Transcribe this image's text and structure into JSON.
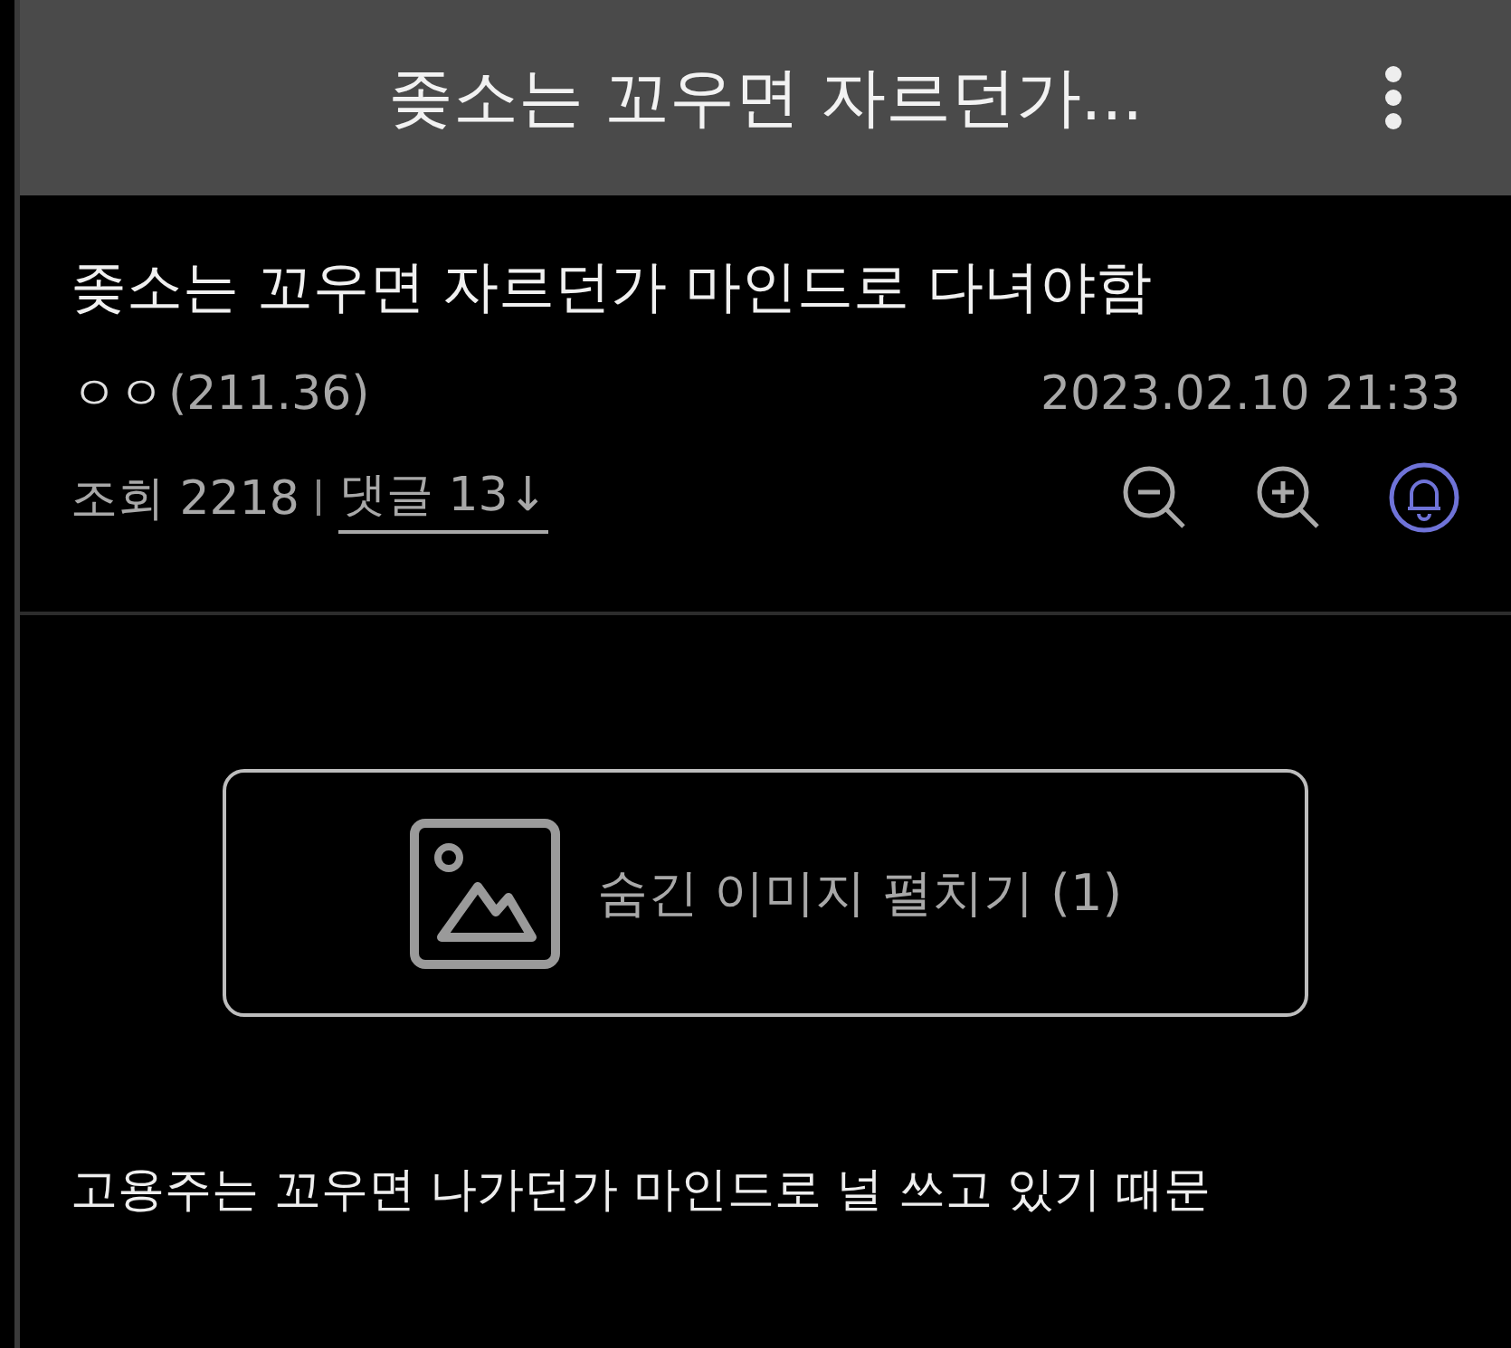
{
  "header": {
    "title": "좆소는 꼬우면 자르던가..."
  },
  "post": {
    "title": "좆소는 꼬우면 자르던가 마인드로 다녀야함",
    "author": "ㅇㅇ",
    "ip": "(211.36)",
    "date": "2023.02.10 21:33",
    "views": "조회 2218",
    "comments": "댓글 13↓",
    "alarm_on": true
  },
  "hidden_images": {
    "label": "숨긴 이미지 펼치기 (1)"
  },
  "body": "고용주는 꼬우면 나가던가 마인드로 널 쓰고 있기 때문"
}
